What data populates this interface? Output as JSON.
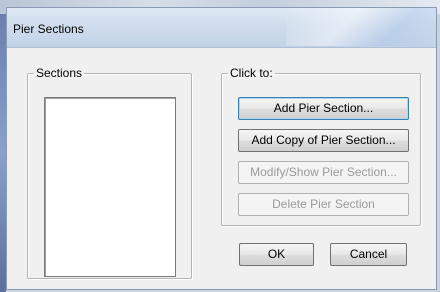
{
  "window": {
    "title": "Pier Sections"
  },
  "sections": {
    "legend": "Sections",
    "items": []
  },
  "click_to": {
    "legend": "Click to:",
    "add": "Add Pier Section...",
    "add_copy": "Add Copy of Pier Section...",
    "modify": "Modify/Show Pier Section...",
    "delete": "Delete Pier Section"
  },
  "footer": {
    "ok": "OK",
    "cancel": "Cancel"
  }
}
